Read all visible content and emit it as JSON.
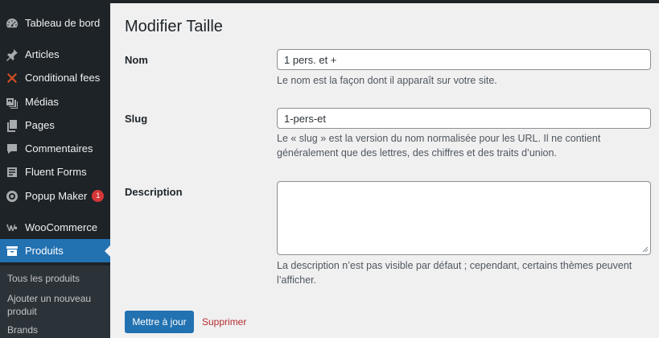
{
  "sidebar": {
    "items": [
      {
        "label": "Tableau de bord",
        "icon": "dashboard-icon"
      },
      {
        "label": "Articles",
        "icon": "pin-icon"
      },
      {
        "label": "Conditional fees",
        "icon": "cross-icon"
      },
      {
        "label": "Médias",
        "icon": "media-icon"
      },
      {
        "label": "Pages",
        "icon": "pages-icon"
      },
      {
        "label": "Commentaires",
        "icon": "comment-icon"
      },
      {
        "label": "Fluent Forms",
        "icon": "forms-icon"
      },
      {
        "label": "Popup Maker",
        "icon": "popup-icon",
        "badge": "1"
      },
      {
        "label": "WooCommerce",
        "icon": "woocommerce-icon"
      },
      {
        "label": "Produits",
        "icon": "archive-icon",
        "active": true
      }
    ],
    "submenu": [
      "Tous les produits",
      "Ajouter un nouveau produit",
      "Brands"
    ]
  },
  "main": {
    "title": "Modifier Taille",
    "name": {
      "label": "Nom",
      "value": "1 pers. et +",
      "help": "Le nom est la façon dont il apparaît sur votre site."
    },
    "slug": {
      "label": "Slug",
      "value": "1-pers-et",
      "help_line1": "Le « slug » est la version du nom normalisée pour les URL. Il ne contient",
      "help_line2": "généralement que des lettres, des chiffres et des traits d’union."
    },
    "description": {
      "label": "Description",
      "value": "",
      "help_line1": "La description n’est pas visible par défaut ; cependant, certains thèmes peuvent",
      "help_line2": "l’afficher."
    },
    "update_button": "Mettre à jour",
    "delete_link": "Supprimer"
  },
  "colors": {
    "sidebar_bg": "#1d2327",
    "accent": "#2271b1",
    "badge": "#d63638",
    "delete": "#b32d2e"
  }
}
